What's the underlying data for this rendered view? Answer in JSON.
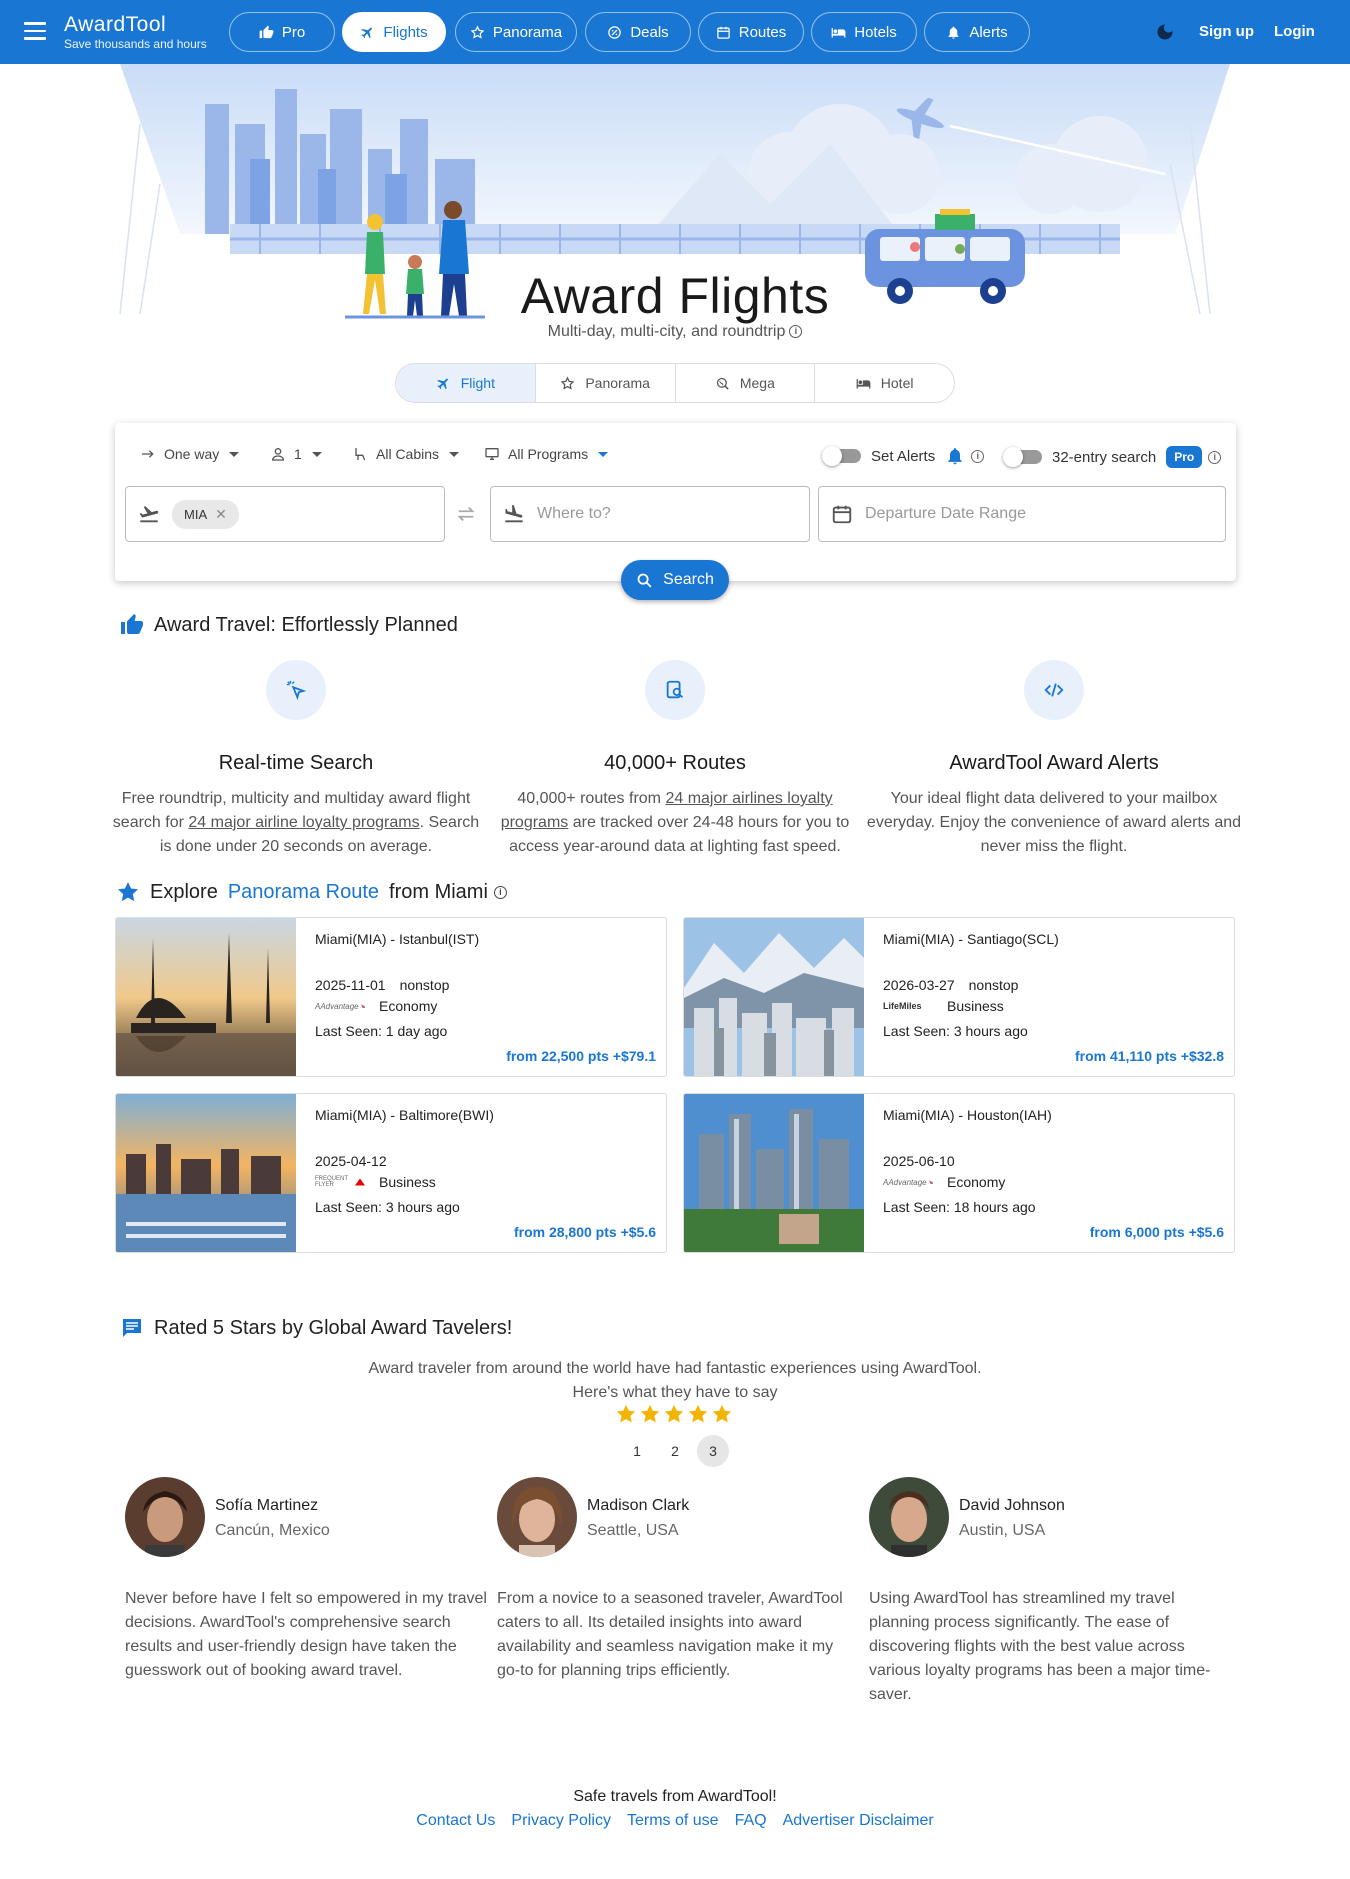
{
  "nav": {
    "brand": "AwardTool",
    "tagline": "Save thousands and hours",
    "items": [
      {
        "label": "Pro",
        "icon": "thumbs-up-icon"
      },
      {
        "label": "Flights",
        "icon": "airplane-icon",
        "active": true
      },
      {
        "label": "Panorama",
        "icon": "star-icon"
      },
      {
        "label": "Deals",
        "icon": "discount-icon"
      },
      {
        "label": "Routes",
        "icon": "calendar-icon"
      },
      {
        "label": "Hotels",
        "icon": "bed-icon"
      },
      {
        "label": "Alerts",
        "icon": "bell-icon"
      }
    ],
    "signup": "Sign up",
    "login": "Login"
  },
  "hero": {
    "title": "Award Flights",
    "subtitle": "Multi-day, multi-city, and roundtrip"
  },
  "mode_tabs": [
    {
      "label": "Flight",
      "active": true
    },
    {
      "label": "Panorama"
    },
    {
      "label": "Mega"
    },
    {
      "label": "Hotel"
    }
  ],
  "search": {
    "trip_type": "One way",
    "passengers": "1",
    "cabins": "All Cabins",
    "programs": "All Programs",
    "set_alerts": "Set Alerts",
    "entry_search": "32-entry search",
    "pro_badge": "Pro",
    "origin_chip": "MIA",
    "destination_placeholder": "Where to?",
    "date_placeholder": "Departure Date Range",
    "button": "Search"
  },
  "features": {
    "heading": "Award Travel: Effortlessly Planned",
    "items": [
      {
        "title": "Real-time Search",
        "pre": "Free roundtrip, multicity and multiday award flight search for ",
        "link": "24 major airline loyalty programs",
        "post": ". Search is done under 20 seconds on average."
      },
      {
        "title": "40,000+ Routes",
        "pre": "40,000+ routes from ",
        "link": "24 major airlines loyalty programs",
        "post": " are tracked over 24-48 hours for you to access year-around data at lighting fast speed."
      },
      {
        "title": "AwardTool Award Alerts",
        "pre": "Your ideal flight data delivered to your mailbox everyday. Enjoy the convenience of award alerts and never miss the flight.",
        "link": "",
        "post": ""
      }
    ]
  },
  "explore": {
    "prefix": "Explore",
    "link": "Panorama Route",
    "suffix": "from Miami",
    "routes": [
      {
        "title": "Miami(MIA) - Istanbul(IST)",
        "date": "2025-11-01",
        "stops": "nonstop",
        "program_logo": "AAdvantage",
        "cabin": "Economy",
        "last_seen": "Last Seen: 1 day ago",
        "price": "from 22,500 pts +$79.1"
      },
      {
        "title": "Miami(MIA) - Santiago(SCL)",
        "date": "2026-03-27",
        "stops": "nonstop",
        "program_logo": "LifeMiles",
        "cabin": "Business",
        "last_seen": "Last Seen: 3 hours ago",
        "price": "from 41,110 pts +$32.8"
      },
      {
        "title": "Miami(MIA) - Baltimore(BWI)",
        "date": "2025-04-12",
        "stops": "",
        "program_logo": "FREQUENT FLYER",
        "cabin": "Business",
        "last_seen": "Last Seen: 3 hours ago",
        "price": "from 28,800 pts +$5.6"
      },
      {
        "title": "Miami(MIA) - Houston(IAH)",
        "date": "2025-06-10",
        "stops": "",
        "program_logo": "AAdvantage",
        "cabin": "Economy",
        "last_seen": "Last Seen: 18 hours ago",
        "price": "from 6,000 pts +$5.6"
      }
    ]
  },
  "reviews": {
    "heading": "Rated 5 Stars by Global Award Tavelers!",
    "intro1": "Award traveler from around the world have had fantastic experiences using AwardTool.",
    "intro2": "Here's what they have to say",
    "rating": 5,
    "pages": [
      "1",
      "2",
      "3"
    ],
    "active_page": "3",
    "items": [
      {
        "name": "Sofía Martinez",
        "location": "Cancún, Mexico",
        "text": "Never before have I felt so empowered in my travel decisions. AwardTool's comprehensive search results and user-friendly design have taken the guesswork out of booking award travel."
      },
      {
        "name": "Madison Clark",
        "location": "Seattle, USA",
        "text": "From a novice to a seasoned traveler, AwardTool caters to all. Its detailed insights into award availability and seamless navigation make it my go-to for planning trips efficiently."
      },
      {
        "name": "David Johnson",
        "location": "Austin, USA",
        "text": "Using AwardTool has streamlined my travel planning process significantly. The ease of discovering flights with the best value across various loyalty programs has been a major time-saver."
      }
    ]
  },
  "footer": {
    "tagline": "Safe travels from AwardTool!",
    "links": [
      "Contact Us",
      "Privacy Policy",
      "Terms of use",
      "FAQ",
      "Advertiser Disclaimer"
    ]
  },
  "colors": {
    "primary": "#1976d2",
    "star": "#f5b301"
  }
}
